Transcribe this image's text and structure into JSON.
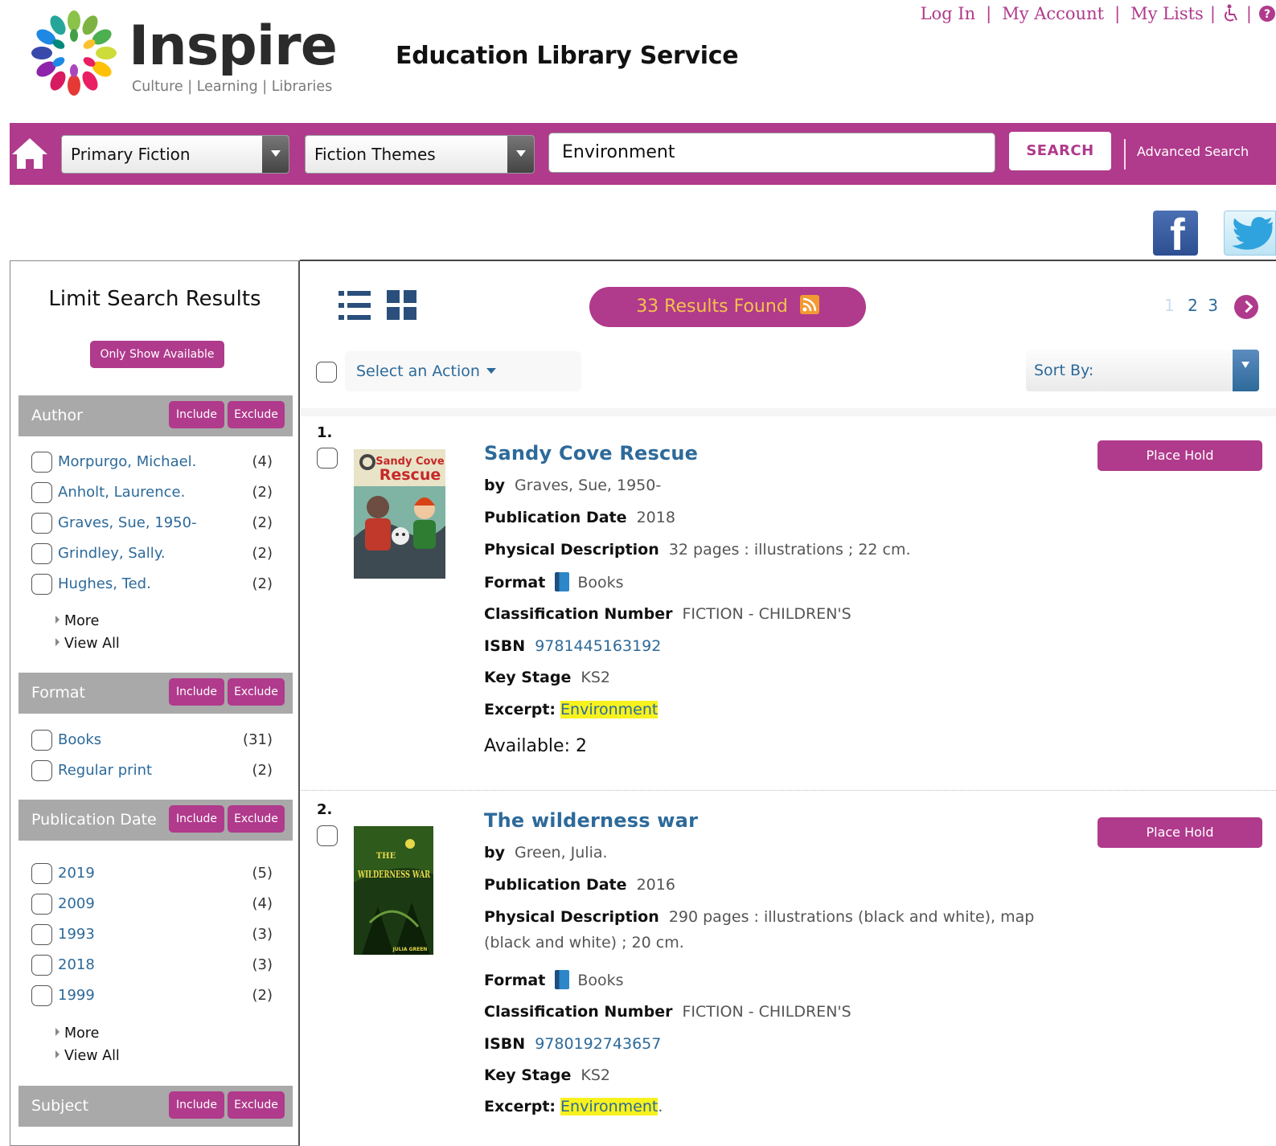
{
  "header": {
    "logo_word": "Inspire",
    "logo_tagline": "Culture | Learning | Libraries",
    "service_title": "Education Library Service",
    "links": [
      "Log In",
      "My Account",
      "My Lists"
    ],
    "link_separator": "|"
  },
  "searchbar": {
    "category_select": "Primary Fiction",
    "subcategory_select": "Fiction Themes",
    "query": "Environment",
    "search_label": "SEARCH",
    "advanced_label": "Advanced Search"
  },
  "sidebar": {
    "title": "Limit Search Results",
    "only_available": "Only Show Available",
    "include_label": "Include",
    "exclude_label": "Exclude",
    "more_label": "More",
    "view_all_label": "View All",
    "facets": {
      "author": {
        "title": "Author",
        "items": [
          {
            "name": "Morpurgo, Michael.",
            "count": "(4)"
          },
          {
            "name": "Anholt, Laurence.",
            "count": "(2)"
          },
          {
            "name": "Graves, Sue, 1950-",
            "count": "(2)"
          },
          {
            "name": "Grindley, Sally.",
            "count": "(2)"
          },
          {
            "name": "Hughes, Ted.",
            "count": "(2)"
          }
        ]
      },
      "format": {
        "title": "Format",
        "items": [
          {
            "name": "Books",
            "count": "(31)"
          },
          {
            "name": "Regular print",
            "count": "(2)"
          }
        ]
      },
      "pubdate": {
        "title": "Publication Date",
        "items": [
          {
            "name": "2019",
            "count": "(5)"
          },
          {
            "name": "2009",
            "count": "(4)"
          },
          {
            "name": "1993",
            "count": "(3)"
          },
          {
            "name": "2018",
            "count": "(3)"
          },
          {
            "name": "1999",
            "count": "(2)"
          }
        ]
      },
      "subject": {
        "title": "Subject"
      }
    }
  },
  "results": {
    "count_label": "33 Results Found",
    "pages": [
      "1",
      "2",
      "3"
    ],
    "action_label": "Select an Action",
    "sort_label": "Sort By:",
    "labels": {
      "by": "by",
      "pubdate": "Publication Date",
      "physical": "Physical Description",
      "format": "Format",
      "classification": "Classification Number",
      "isbn": "ISBN",
      "keystage": "Key Stage",
      "excerpt": "Excerpt:",
      "hold": "Place Hold"
    },
    "records": [
      {
        "num": "1.",
        "title": "Sandy Cove Rescue",
        "cover_title_1": "Sandy Cove",
        "cover_title_2": "Rescue",
        "author": "Graves, Sue, 1950-",
        "pubdate": "2018",
        "physical": "32 pages : illustrations ; 22 cm.",
        "format": "Books",
        "classification": "FICTION - CHILDREN'S",
        "isbn": "9781445163192",
        "keystage": "KS2",
        "excerpt": "Environment",
        "excerpt_suffix": "",
        "available": "Available: 2"
      },
      {
        "num": "2.",
        "title": "The wilderness war",
        "cover_title_1": "THE",
        "cover_title_2": "WILDERNESS WAR",
        "cover_author": "JULIA GREEN",
        "author": "Green, Julia.",
        "pubdate": "2016",
        "physical": "290 pages : illustrations (black and white), map (black and white) ; 20 cm.",
        "format": "Books",
        "classification": "FICTION - CHILDREN'S",
        "isbn": "9780192743657",
        "keystage": "KS2",
        "excerpt": "Environment",
        "excerpt_suffix": "."
      }
    ]
  },
  "colors": {
    "brand": "#b03a8c",
    "link": "#2d6a9a",
    "facet_header": "#a9a9a9",
    "highlight": "#f7f21e"
  }
}
